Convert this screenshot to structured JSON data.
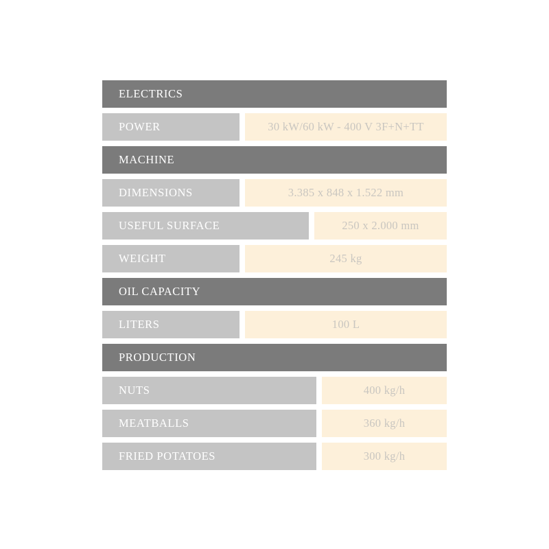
{
  "table": {
    "sections": [
      {
        "title": "ELECTRICS",
        "rows": [
          {
            "label": "POWER",
            "value": "30 kW/60 kW - 400 V 3F+N+TT",
            "label_width": "narrow"
          }
        ]
      },
      {
        "title": "MACHINE",
        "rows": [
          {
            "label": "DIMENSIONS",
            "value": "3.385 x 848 x 1.522 mm",
            "label_width": "narrow"
          },
          {
            "label": "USEFUL SURFACE",
            "value": "250 x 2.000 mm",
            "label_width": "mid"
          },
          {
            "label": "WEIGHT",
            "value": "245 kg",
            "label_width": "narrow"
          }
        ]
      },
      {
        "title": "OIL CAPACITY",
        "rows": [
          {
            "label": "LITERS",
            "value": "100 L",
            "label_width": "narrow"
          }
        ]
      },
      {
        "title": "PRODUCTION",
        "rows": [
          {
            "label": "NUTS",
            "value": "400 kg/h",
            "label_width": "wide"
          },
          {
            "label": "MEATBALLS",
            "value": "360 kg/h",
            "label_width": "wide"
          },
          {
            "label": "FRIED POTATOES",
            "value": "300 kg/h",
            "label_width": "wide"
          }
        ]
      }
    ]
  },
  "colors": {
    "section_header_bg": "#7b7b7b",
    "label_bg": "#c4c4c4",
    "value_bg": "#fdf0da",
    "header_text": "#ffffff",
    "label_text": "#ffffff",
    "value_text": "#c9c6c0",
    "page_bg": "#ffffff"
  }
}
